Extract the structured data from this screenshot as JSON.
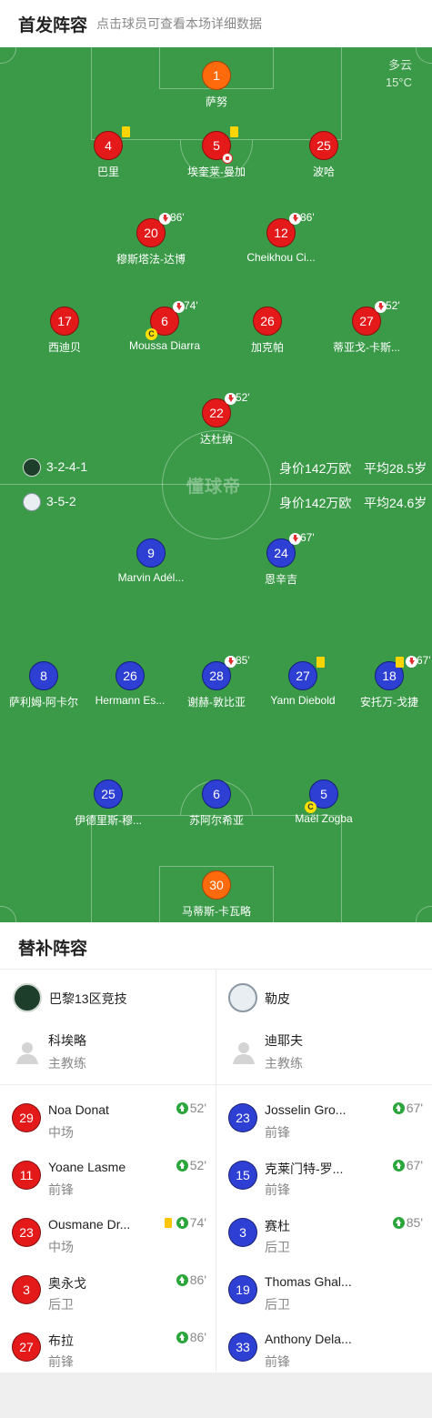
{
  "header": {
    "title": "首发阵容",
    "subtitle": "点击球员可查看本场详细数据"
  },
  "weather": {
    "condition": "多云",
    "temperature": "15°C"
  },
  "watermark": "懂球帝",
  "home_team": {
    "formation": "3-2-4-1",
    "value": "身价142万欧",
    "avg_age": "平均28.5岁",
    "players": [
      {
        "number": "1",
        "name": "萨努",
        "gk": true
      },
      {
        "number": "4",
        "name": "巴里",
        "yellow": true
      },
      {
        "number": "5",
        "name": "埃奎莱-曼加",
        "yellow": true,
        "goal": true
      },
      {
        "number": "25",
        "name": "波哈"
      },
      {
        "number": "20",
        "name": "穆斯塔法-达博",
        "sub": "86'"
      },
      {
        "number": "12",
        "name": "Cheikhou Ci...",
        "sub": "86'"
      },
      {
        "number": "17",
        "name": "西迪贝"
      },
      {
        "number": "6",
        "name": "Moussa Diarra",
        "sub": "74'",
        "captain": "C"
      },
      {
        "number": "26",
        "name": "加克帕"
      },
      {
        "number": "27",
        "name": "蒂亚戈-卡斯...",
        "sub": "52'"
      },
      {
        "number": "22",
        "name": "达杜纳",
        "sub": "52'"
      }
    ]
  },
  "away_team": {
    "formation": "3-5-2",
    "value": "身价142万欧",
    "avg_age": "平均24.6岁",
    "players": [
      {
        "number": "9",
        "name": "Marvin Adél..."
      },
      {
        "number": "24",
        "name": "恩辛吉",
        "sub": "67'"
      },
      {
        "number": "8",
        "name": "萨利姆-阿卡尔"
      },
      {
        "number": "26",
        "name": "Hermann Es..."
      },
      {
        "number": "28",
        "name": "谢赫-敦比亚",
        "sub": "85'"
      },
      {
        "number": "27",
        "name": "Yann Diebold",
        "yellow": true
      },
      {
        "number": "18",
        "name": "安托万-戈捷",
        "yellow": true,
        "sub": "67'"
      },
      {
        "number": "25",
        "name": "伊德里斯-穆..."
      },
      {
        "number": "6",
        "name": "苏阿尔希亚"
      },
      {
        "number": "5",
        "name": "Maël Zogba",
        "captain": "C"
      },
      {
        "number": "30",
        "name": "马蒂斯-卡瓦略",
        "gk": true
      }
    ]
  },
  "subs": {
    "title": "替补阵容",
    "home": {
      "team": "巴黎13区竞技",
      "coach": {
        "name": "科埃略",
        "role": "主教练"
      },
      "players": [
        {
          "number": "29",
          "name": "Noa Donat",
          "pos": "中场",
          "time": "52'"
        },
        {
          "number": "11",
          "name": "Yoane Lasme",
          "pos": "前锋",
          "time": "52'"
        },
        {
          "number": "23",
          "name": "Ousmane Dr...",
          "pos": "中场",
          "time": "74'",
          "yellow": true
        },
        {
          "number": "3",
          "name": "奥永戈",
          "pos": "后卫",
          "time": "86'"
        },
        {
          "number": "27",
          "name": "布拉",
          "pos": "前锋",
          "time": "86'"
        }
      ]
    },
    "away": {
      "team": "勒皮",
      "coach": {
        "name": "迪耶夫",
        "role": "主教练"
      },
      "players": [
        {
          "number": "23",
          "name": "Josselin Gro...",
          "pos": "前锋",
          "time": "67'"
        },
        {
          "number": "15",
          "name": "克莱门特-罗...",
          "pos": "前锋",
          "time": "67'"
        },
        {
          "number": "3",
          "name": "赛杜",
          "pos": "后卫",
          "time": "85'"
        },
        {
          "number": "19",
          "name": "Thomas Ghal...",
          "pos": "后卫",
          "time": ""
        },
        {
          "number": "33",
          "name": "Anthony Dela...",
          "pos": "前锋",
          "time": ""
        }
      ]
    }
  },
  "colors": {
    "home": "#e41a1a",
    "away": "#2e3fd4",
    "gk": "#ff6a0c",
    "pitch": "#3a9a48"
  }
}
